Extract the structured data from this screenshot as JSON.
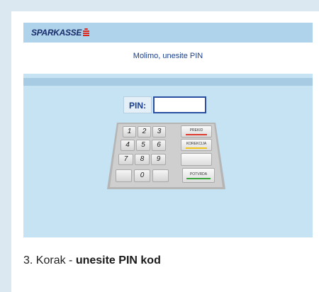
{
  "brand": {
    "name": "SPARKASSE"
  },
  "screen": {
    "title": "Molimo, unesite PIN",
    "pin_label": "PIN:",
    "pin_value": ""
  },
  "keypad": {
    "digits": [
      "1",
      "2",
      "3",
      "4",
      "5",
      "6",
      "7",
      "8",
      "9",
      "0"
    ],
    "functions": {
      "cancel": "PREKID",
      "correction": "KOREKCIJA",
      "confirm": "POTVRDA"
    }
  },
  "colors": {
    "cancel": "#e03a2e",
    "correction": "#f0c419",
    "confirm": "#3aa53a"
  },
  "caption": {
    "prefix": "3. Korak - ",
    "emphasis": "unesite PIN kod"
  }
}
